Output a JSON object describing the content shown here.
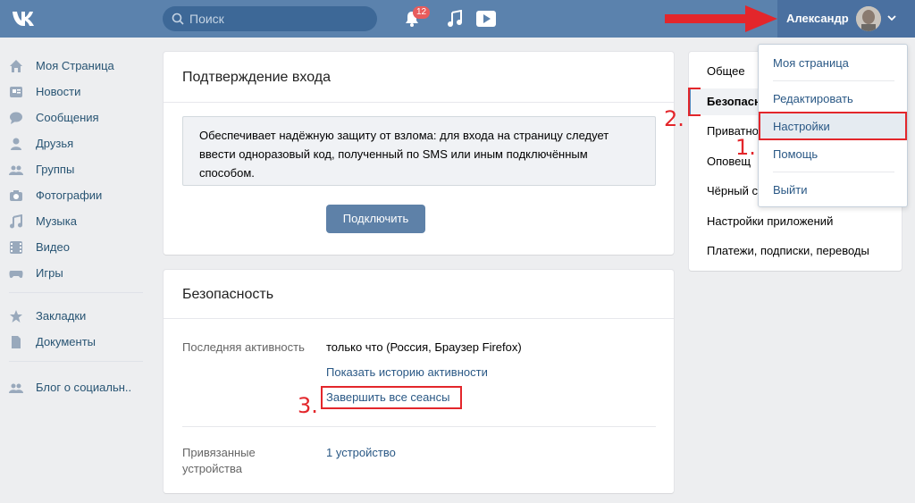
{
  "header": {
    "search_placeholder": "Поиск",
    "notifications_count": "12",
    "user_name": "Александр"
  },
  "sidebar": {
    "items": [
      {
        "label": "Моя Страница",
        "icon": "home-icon"
      },
      {
        "label": "Новости",
        "icon": "news-icon"
      },
      {
        "label": "Сообщения",
        "icon": "messages-icon"
      },
      {
        "label": "Друзья",
        "icon": "friends-icon"
      },
      {
        "label": "Группы",
        "icon": "groups-icon"
      },
      {
        "label": "Фотографии",
        "icon": "camera-icon"
      },
      {
        "label": "Музыка",
        "icon": "music-icon"
      },
      {
        "label": "Видео",
        "icon": "video-icon"
      },
      {
        "label": "Игры",
        "icon": "gamepad-icon"
      },
      {
        "label": "Закладки",
        "icon": "star-icon"
      },
      {
        "label": "Документы",
        "icon": "document-icon"
      },
      {
        "label": "Блог о социальн..",
        "icon": "people-icon"
      }
    ]
  },
  "login_confirmation": {
    "title": "Подтверждение входа",
    "notice": "Обеспечивает надёжную защиту от взлома: для входа на страницу следует ввести одноразовый код, полученный по SMS или иным подключённым способом.",
    "button": "Подключить"
  },
  "security": {
    "title": "Безопасность",
    "last_activity_label": "Последняя активность",
    "last_activity_value": "только что (Россия, Браузер Firefox)",
    "show_history_link": "Показать историю активности",
    "end_sessions_link": "Завершить все сеансы",
    "linked_devices_label": "Привязанные устройства",
    "linked_devices_value": "1 устройство"
  },
  "settings_menu": {
    "items": [
      "Общее",
      "Безопасность",
      "Приватность",
      "Оповещения",
      "Чёрный список",
      "Настройки приложений",
      "Платежи, подписки, переводы"
    ],
    "visible_labels": [
      "Общее",
      "Безопаснос",
      "Приватно",
      "Оповещ",
      "Чёрный с",
      "Настройки приложений",
      "Платежи, подписки, переводы"
    ]
  },
  "user_dropdown": {
    "items": [
      "Моя страница",
      "Редактировать",
      "Настройки",
      "Помощь",
      "Выйти"
    ]
  },
  "annotations": {
    "step1": "1.",
    "step2": "2.",
    "step3": "3."
  },
  "colors": {
    "header_bg": "#5b82ad",
    "link": "#2a5885",
    "annotation_red": "#e3262b",
    "button_bg": "#5e81a8"
  }
}
